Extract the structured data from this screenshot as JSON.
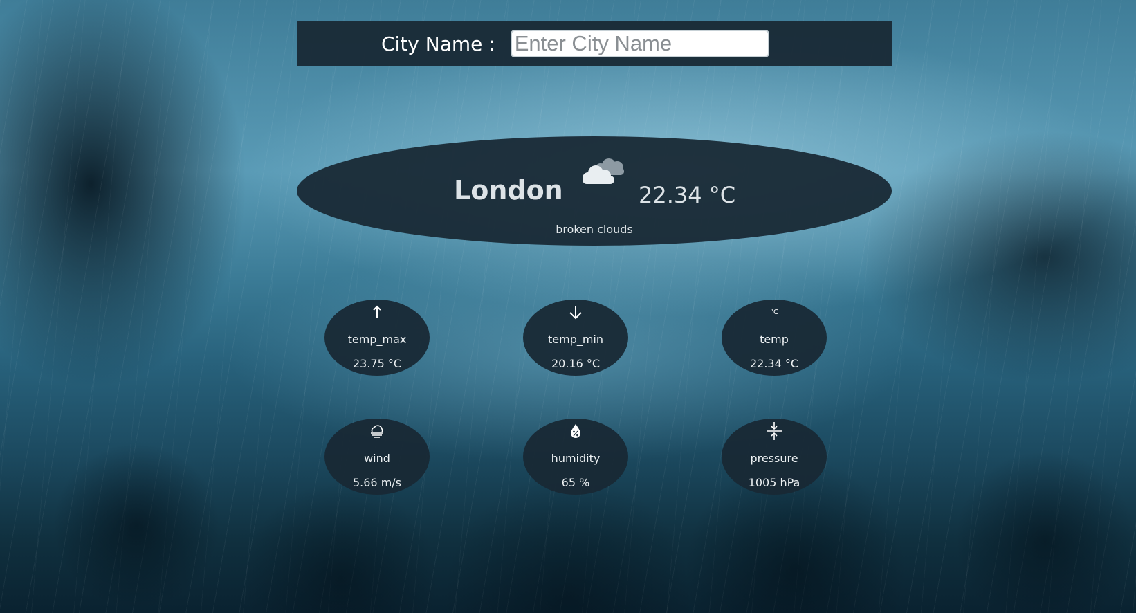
{
  "search": {
    "label": "City Name :",
    "placeholder": "Enter City Name",
    "value": ""
  },
  "current": {
    "city": "London",
    "temperature": "22.34 °C",
    "description": "broken clouds",
    "icon": "broken-clouds-icon"
  },
  "stats": [
    {
      "icon": "arrow-up-icon",
      "label": "temp_max",
      "value": "23.75 °C"
    },
    {
      "icon": "arrow-down-icon",
      "label": "temp_min",
      "value": "20.16 °C"
    },
    {
      "icon": "celsius-icon",
      "icon_text": "°C",
      "label": "temp",
      "value": "22.34 °C"
    },
    {
      "icon": "wind-icon",
      "label": "wind",
      "value": "5.66 m/s"
    },
    {
      "icon": "humidity-drop-icon",
      "label": "humidity",
      "value": "65 %"
    },
    {
      "icon": "pressure-icon",
      "label": "pressure",
      "value": "1005 hPa"
    }
  ]
}
